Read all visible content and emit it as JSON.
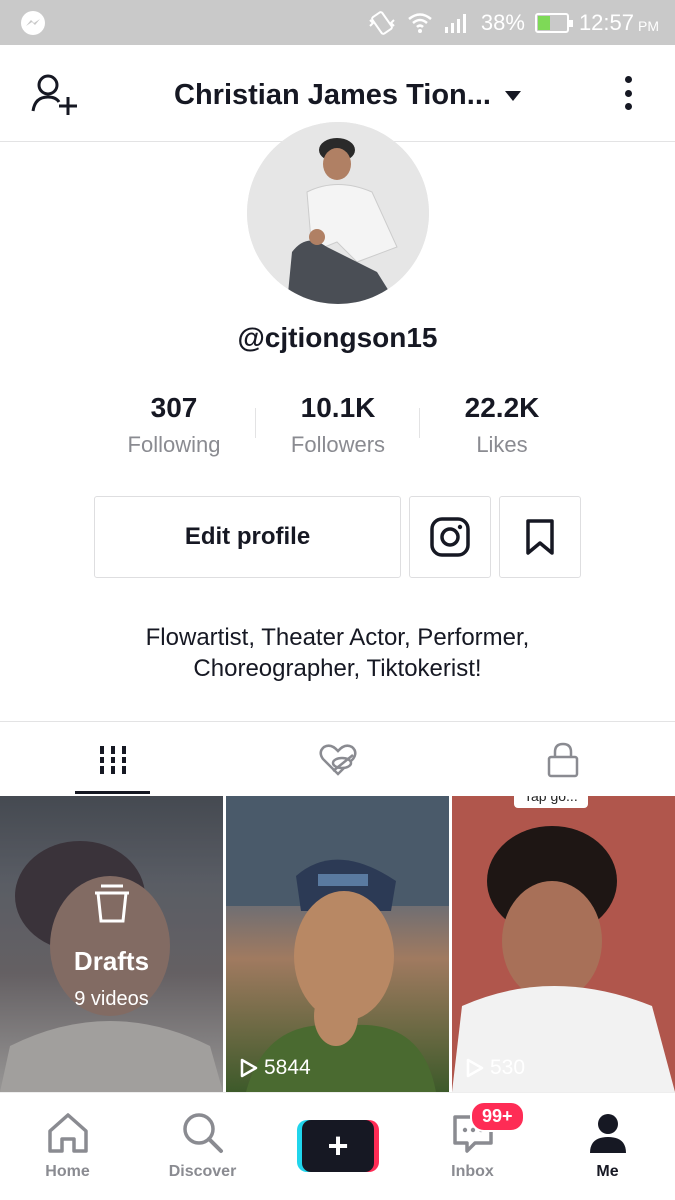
{
  "status_bar": {
    "battery": "38%",
    "time": "12:57",
    "ampm": "PM",
    "icons": [
      "messenger-icon",
      "vibrate-icon",
      "wifi-icon",
      "signal-icon",
      "battery-icon"
    ]
  },
  "header": {
    "profile_name": "Christian James Tion...",
    "icons": [
      "add-user-icon",
      "chevron-down-icon",
      "more-vertical-icon"
    ]
  },
  "profile": {
    "username": "@cjtiongson15",
    "stats": [
      {
        "value": "307",
        "label": "Following"
      },
      {
        "value": "10.1K",
        "label": "Followers"
      },
      {
        "value": "22.2K",
        "label": "Likes"
      }
    ],
    "edit_profile_label": "Edit profile",
    "bio_line1": "Flowartist, Theater Actor, Performer,",
    "bio_line2": "Choreographer, Tiktokerist!"
  },
  "tabs": [
    {
      "icon": "grid-icon",
      "active": true
    },
    {
      "icon": "liked-hidden-icon",
      "active": false
    },
    {
      "icon": "lock-icon",
      "active": false
    }
  ],
  "videos": {
    "drafts_title": "Drafts",
    "drafts_count": "9 videos",
    "items": [
      {
        "views": "5844"
      },
      {
        "views": "530"
      }
    ],
    "chip_text": "Tap go..."
  },
  "bottom_nav": {
    "items": [
      {
        "label": "Home",
        "icon": "home-icon"
      },
      {
        "label": "Discover",
        "icon": "search-icon"
      },
      {
        "label": "",
        "icon": "plus-icon"
      },
      {
        "label": "Inbox",
        "icon": "inbox-icon"
      },
      {
        "label": "Me",
        "icon": "profile-icon"
      }
    ],
    "inbox_badge": "99+"
  },
  "colors": {
    "primary_text": "#161823",
    "secondary_text": "#8a8b91",
    "accent_red": "#fe2c55",
    "accent_cyan": "#20d5ec",
    "status_bar": "#c9c9c9"
  }
}
